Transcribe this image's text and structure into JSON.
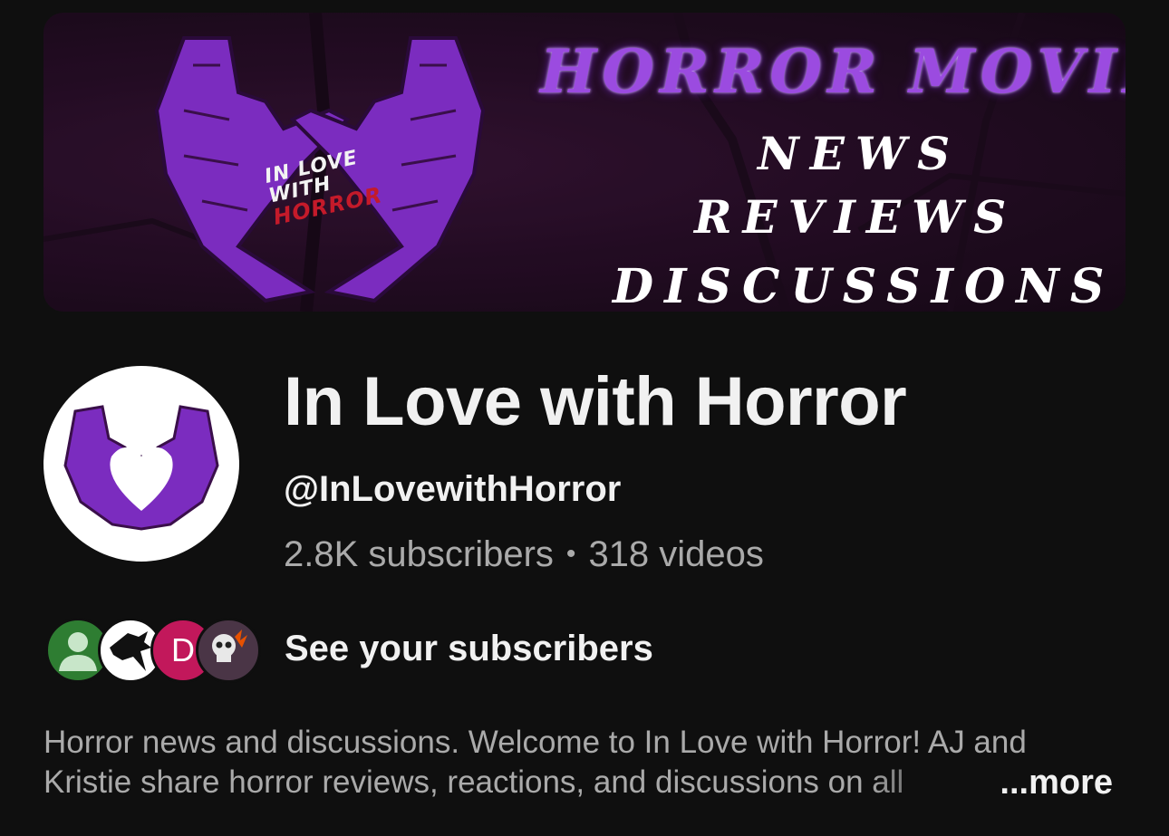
{
  "banner": {
    "logo_line1": "IN LOVE",
    "logo_line2": "WITH",
    "logo_line3": "HORROR",
    "title": "HORROR MOVIE",
    "line_news": "NEWS",
    "line_reviews": "REVIEWS",
    "line_discussions": "DISCUSSIONS"
  },
  "channel": {
    "name": "In Love with Horror",
    "handle": "@InLovewithHorror",
    "subscribers": "2.8K subscribers",
    "separator": "•",
    "videos": "318 videos"
  },
  "subscribers_row": {
    "avatar3_letter": "D",
    "label": "See your subscribers"
  },
  "description": {
    "line1": "Horror news and discussions. Welcome to In Love with Horror! AJ and",
    "line2": "Kristie share horror reviews, reactions, and discussions on all",
    "more_label": "...more"
  },
  "colors": {
    "background": "#0f0f0f",
    "purple": "#7b2cbf",
    "banner_bg": "#2a0f2a",
    "secondary_text": "#aaaaaa"
  }
}
